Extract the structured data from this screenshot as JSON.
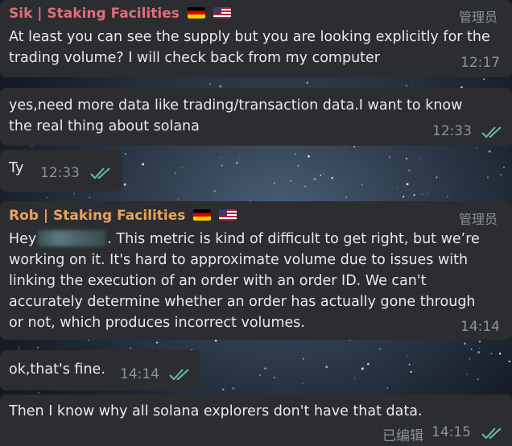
{
  "messages": [
    {
      "sender": "Sik | Staking Facilities",
      "sender_color": "#e56c7a",
      "role": "管理员",
      "lines": [
        "At least you can see the supply but you are looking explicitly for the",
        "trading volume? I will check back from my computer"
      ],
      "time": "12:17"
    },
    {
      "lines": [
        "yes,need more data like trading/transaction data.I want to know",
        "the real thing about solana"
      ],
      "time": "12:33",
      "read": true
    },
    {
      "lines": [
        "Ty"
      ],
      "time": "12:33",
      "read": true
    },
    {
      "sender": "Rob | Staking Facilities",
      "sender_color": "#e9a45a",
      "role": "管理员",
      "greeting": "Hey",
      "line0_rest": ". This metric is kind of difficult to get right, but we’re",
      "lines": [
        "working on it.  It's hard to approximate volume due to issues with",
        "linking the execution of an order with an order ID. We can't",
        "accurately determine whether an order has actually gone through",
        "or not, which produces incorrect volumes."
      ],
      "time": "14:14"
    },
    {
      "lines": [
        "ok,that's fine."
      ],
      "time": "14:14",
      "read": true
    },
    {
      "lines": [
        "Then I know why all solana explorers don't have that data."
      ],
      "edited": "已编辑",
      "time": "14:15",
      "read": true
    }
  ],
  "colors": {
    "bubble": "#2b2d31",
    "check": "#5fbfb0",
    "meta": "#8d939b"
  }
}
